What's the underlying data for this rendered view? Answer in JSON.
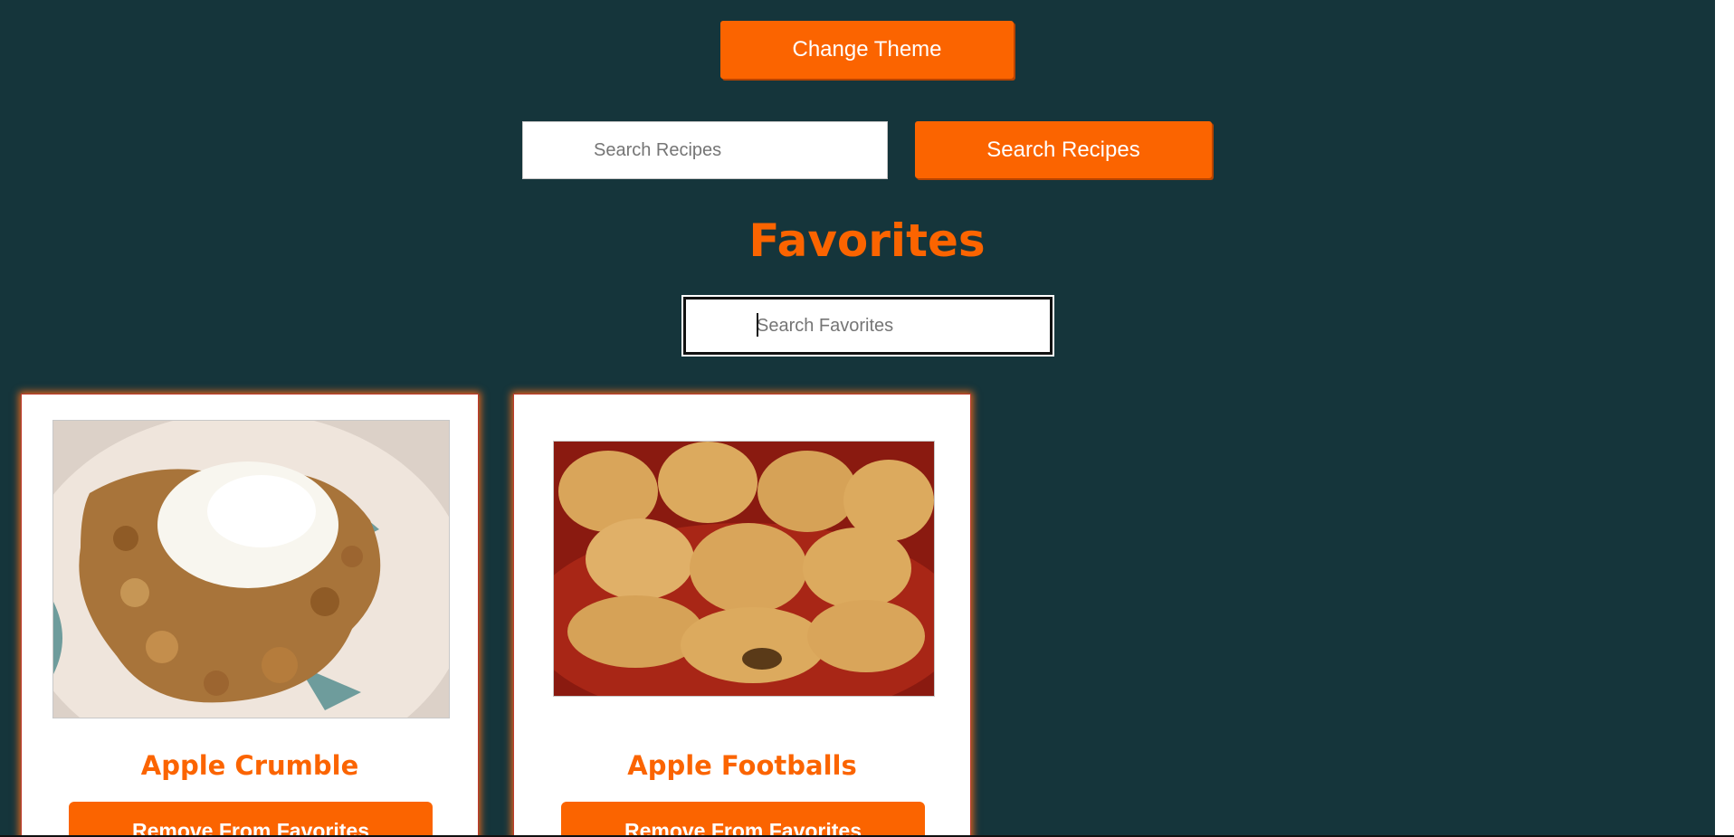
{
  "header": {
    "theme_button_label": "Change Theme"
  },
  "search": {
    "recipes_placeholder": "Search Recipes",
    "search_button_label": "Search Recipes"
  },
  "favorites": {
    "heading": "Favorites",
    "filter_placeholder": "Search Favorites",
    "cards": [
      {
        "title": "Apple Crumble",
        "image": "apple-crumble-photo",
        "button_label": "Remove From Favorites"
      },
      {
        "title": "Apple Footballs",
        "image": "apple-footballs-photo",
        "button_label": "Remove From Favorites"
      }
    ]
  },
  "colors": {
    "background": "#15353b",
    "accent": "#fb6400",
    "card_background": "#ffffff"
  }
}
